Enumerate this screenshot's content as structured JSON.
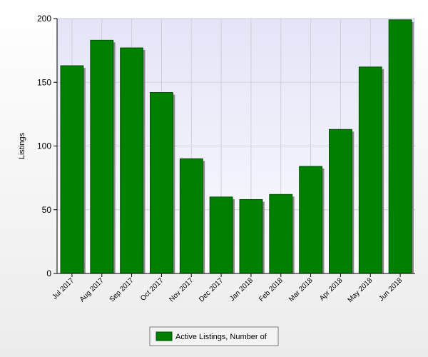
{
  "colors": {
    "bar_fill": "#008000",
    "bar_edge": "#004d00",
    "bar_shadow": "#8a8a8a",
    "plot_top": "#e4e4f7",
    "plot_bottom": "#fbfbff",
    "page_top": "#ffffff",
    "page_bottom": "#ececec",
    "grid": "#cfcfdf",
    "axis": "#000000"
  },
  "chart_data": {
    "type": "bar",
    "title": "",
    "xlabel": "",
    "ylabel": "Listings",
    "categories": [
      "Jul 2017",
      "Aug 2017",
      "Sep 2017",
      "Oct 2017",
      "Nov 2017",
      "Dec 2017",
      "Jan 2018",
      "Feb 2018",
      "Mar 2018",
      "Apr 2018",
      "May 2018",
      "Jun 2018"
    ],
    "series": [
      {
        "name": "Active Listings, Number of",
        "values": [
          163,
          183,
          177,
          142,
          90,
          60,
          58,
          62,
          84,
          113,
          162,
          199
        ]
      }
    ],
    "ylim": [
      0,
      200
    ],
    "yticks": [
      0,
      50,
      100,
      150,
      200
    ],
    "grid": true,
    "legend_position": "bottom-center"
  }
}
